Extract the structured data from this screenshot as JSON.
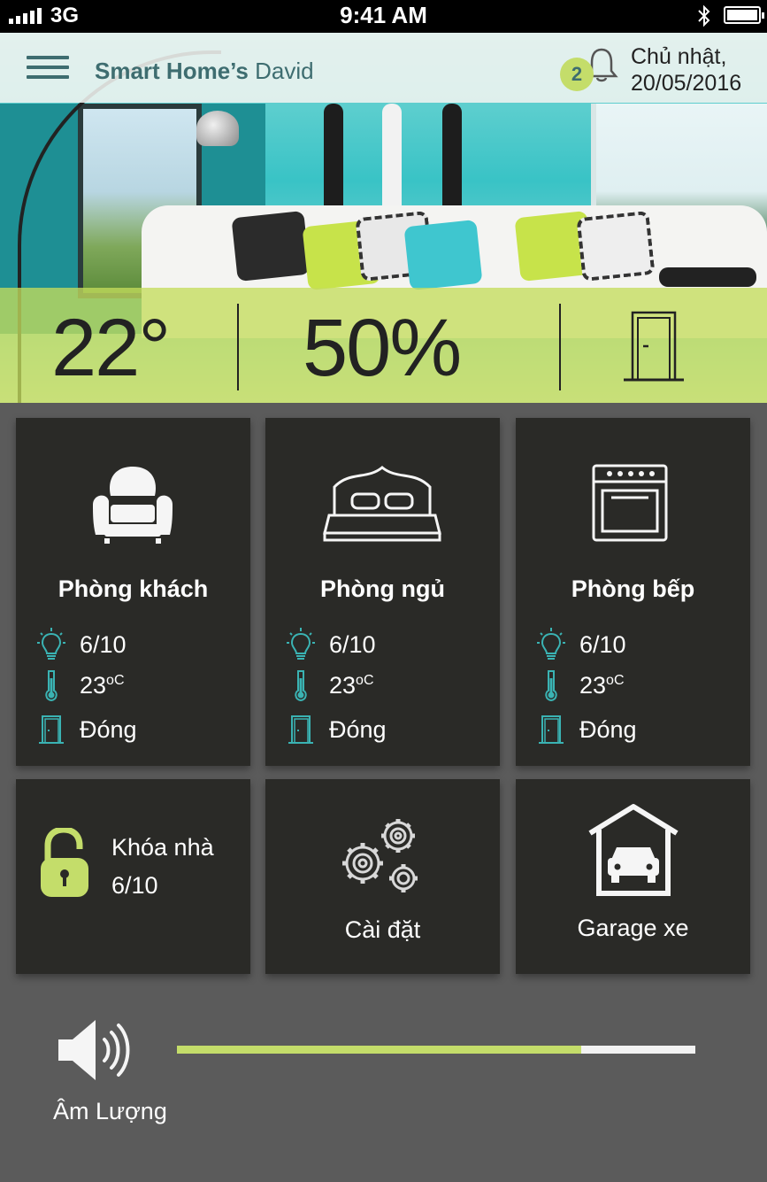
{
  "status_bar": {
    "network": "3G",
    "time": "9:41 AM"
  },
  "header": {
    "brand_bold": "Smart Home’s",
    "brand_user": "David",
    "notification_count": "2",
    "date_line1": "Chủ nhật,",
    "date_line2": "20/05/2016"
  },
  "overview": {
    "temperature": "22°",
    "humidity": "50%",
    "door_icon": "door-icon"
  },
  "rooms": [
    {
      "title": "Phòng khách",
      "icon": "armchair-icon",
      "lights": "6/10",
      "temp": "23",
      "temp_unit": "oC",
      "door": "Đóng"
    },
    {
      "title": "Phòng ngủ",
      "icon": "bed-icon",
      "lights": "6/10",
      "temp": "23",
      "temp_unit": "oC",
      "door": "Đóng"
    },
    {
      "title": "Phòng bếp",
      "icon": "oven-icon",
      "lights": "6/10",
      "temp": "23",
      "temp_unit": "oC",
      "door": "Đóng"
    }
  ],
  "lock": {
    "label": "Khóa nhà",
    "value": "6/10",
    "icon": "unlocked-padlock-icon"
  },
  "settings": {
    "label": "Cài đặt",
    "icon": "gears-icon"
  },
  "garage": {
    "label": "Garage xe",
    "icon": "garage-icon"
  },
  "volume": {
    "label": "Âm Lượng",
    "level": 0.78,
    "icon": "speaker-icon"
  },
  "colors": {
    "accent": "#c4dd6a",
    "teal": "#3e6d70",
    "tile": "#2a2a27",
    "background": "#5b5b5b",
    "icon_teal": "#3ab3b3"
  }
}
